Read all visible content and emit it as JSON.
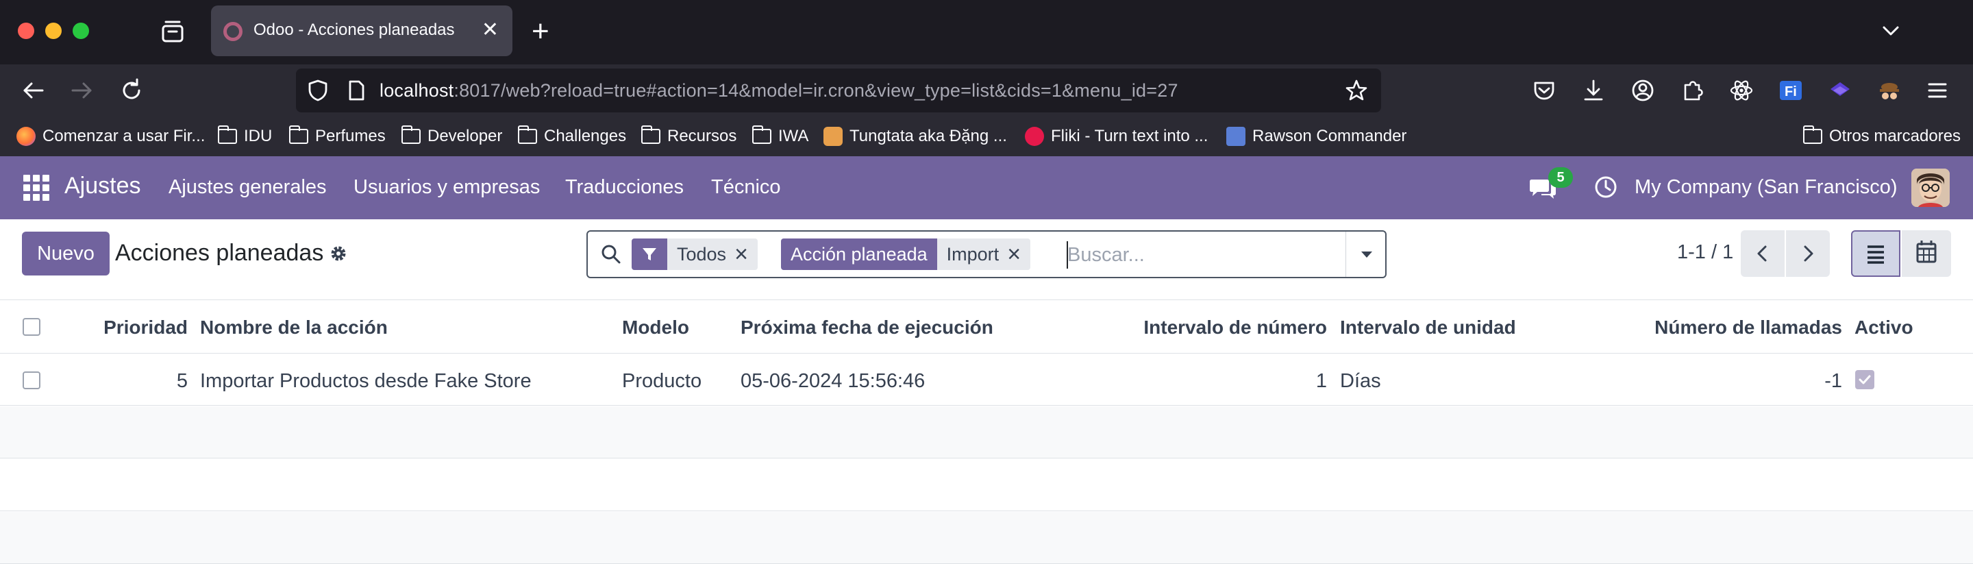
{
  "browser": {
    "tab_title": "Odoo - Acciones planeadas",
    "tab_close": "✕",
    "new_tab": "+",
    "url_host": "localhost",
    "url_rest": ":8017/web?reload=true#action=14&model=ir.cron&view_type=list&cids=1&menu_id=27"
  },
  "bookmarks": {
    "items": [
      {
        "label": "Comenzar a usar Fir...",
        "icon": "firefox-icon",
        "color": "#ff7139"
      },
      {
        "label": "IDU",
        "icon": "folder-icon"
      },
      {
        "label": "Perfumes",
        "icon": "folder-icon"
      },
      {
        "label": "Developer",
        "icon": "folder-icon"
      },
      {
        "label": "Challenges",
        "icon": "folder-icon"
      },
      {
        "label": "Recursos",
        "icon": "folder-icon"
      },
      {
        "label": "IWA",
        "icon": "folder-icon"
      },
      {
        "label": "Tungtata aka Đặng ...",
        "icon": "site-icon",
        "color": "#e8a04c"
      },
      {
        "label": "Fliki - Turn text into ...",
        "icon": "fliki-icon",
        "color": "#e6194b"
      },
      {
        "label": "Rawson Commander",
        "icon": "site-icon",
        "color": "#5a7fd6"
      }
    ],
    "other": "Otros marcadores"
  },
  "odoo_nav": {
    "brand": "Ajustes",
    "menus": [
      "Ajustes generales",
      "Usuarios y empresas",
      "Traducciones",
      "Técnico"
    ],
    "chat_badge": "5",
    "company": "My Company (San Francisco)",
    "accent": "#71639e"
  },
  "control_panel": {
    "new_button": "Nuevo",
    "title": "Acciones planeadas",
    "facets": [
      {
        "tag_icon": "filter-icon",
        "value": "Todos"
      },
      {
        "tag": "Acción planeada",
        "value": "Import"
      }
    ],
    "search_placeholder": "Buscar...",
    "pager": "1-1 / 1"
  },
  "table": {
    "columns": [
      "Prioridad",
      "Nombre de la acción",
      "Modelo",
      "Próxima fecha de ejecución",
      "Intervalo de número",
      "Intervalo de unidad",
      "Número de llamadas",
      "Activo"
    ],
    "rows": [
      {
        "priority": "5",
        "name": "Importar Productos desde Fake Store",
        "model": "Producto",
        "next_call": "05-06-2024 15:56:46",
        "interval_number": "1",
        "interval_unit": "Días",
        "numbercall": "-1",
        "active": true
      }
    ]
  }
}
